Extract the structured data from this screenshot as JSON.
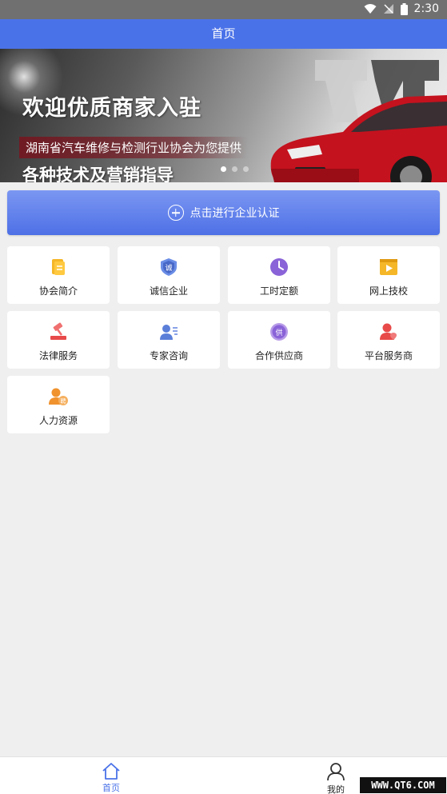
{
  "status_bar": {
    "time": "2:30"
  },
  "header": {
    "title": "首页"
  },
  "banner": {
    "headline": "欢迎优质商家入驻",
    "subtitle": "湖南省汽车维修与检测行业协会为您提供",
    "slogan": "各种技术及营销指导",
    "slide_count": 3,
    "active_slide": 0
  },
  "cert_button": {
    "label": "点击进行企业认证"
  },
  "menu": [
    {
      "label": "协会简介",
      "icon": "document-icon",
      "color": "#f5b728"
    },
    {
      "label": "诚信企业",
      "icon": "shield-icon",
      "color": "#5b7fd9"
    },
    {
      "label": "工时定额",
      "icon": "clock-icon",
      "color": "#8a63d8"
    },
    {
      "label": "网上技校",
      "icon": "video-icon",
      "color": "#f5b728"
    },
    {
      "label": "法律服务",
      "icon": "gavel-icon",
      "color": "#e84a4a"
    },
    {
      "label": "专家咨询",
      "icon": "expert-icon",
      "color": "#5b7fd9"
    },
    {
      "label": "合作供应商",
      "icon": "supplier-badge-icon",
      "color": "#8a63d8"
    },
    {
      "label": "平台服务商",
      "icon": "service-user-icon",
      "color": "#e84a4a"
    },
    {
      "label": "人力资源",
      "icon": "hr-user-icon",
      "color": "#f0922e"
    }
  ],
  "bottom_nav": [
    {
      "label": "首页",
      "icon": "home-icon",
      "active": true
    },
    {
      "label": "我的",
      "icon": "user-icon",
      "active": false
    }
  ],
  "watermark": "WWW.QT6.COM",
  "colors": {
    "primary": "#4a72e8",
    "background": "#efefef"
  }
}
